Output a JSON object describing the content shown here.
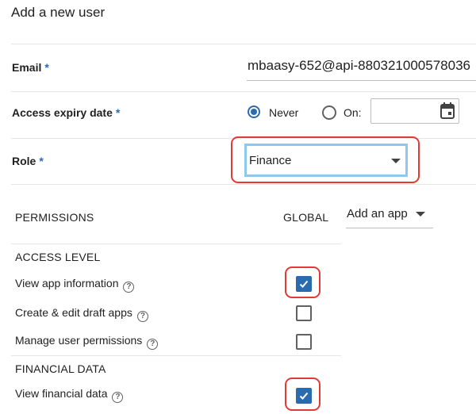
{
  "form": {
    "title": "Add a new user",
    "required_mark": "*",
    "email": {
      "label": "Email",
      "value": "mbaasy-652@api-880321000578036"
    },
    "access_expiry": {
      "label": "Access expiry date",
      "options": [
        {
          "label": "Never",
          "selected": true
        },
        {
          "label": "On:",
          "selected": false
        }
      ],
      "date_value": ""
    },
    "role": {
      "label": "Role",
      "value": "Finance"
    }
  },
  "permissions": {
    "header": "PERMISSIONS",
    "global_label": "GLOBAL",
    "add_app_label": "Add an app",
    "sections": [
      {
        "title": "ACCESS LEVEL",
        "items": [
          {
            "label": "View app information",
            "checked": true,
            "highlighted": true
          },
          {
            "label": "Create & edit draft apps",
            "checked": false,
            "highlighted": false
          },
          {
            "label": "Manage user permissions",
            "checked": false,
            "highlighted": false
          }
        ]
      },
      {
        "title": "FINANCIAL DATA",
        "items": [
          {
            "label": "View financial data",
            "checked": true,
            "highlighted": true
          }
        ]
      }
    ]
  },
  "colors": {
    "accent": "#2a6bb0",
    "highlight_outline": "#e53935",
    "select_focus": "#8ec8ec"
  },
  "icons": {
    "help": "question-circle-icon",
    "calendar": "calendar-icon",
    "dropdown": "caret-down-icon",
    "check": "check-icon"
  }
}
